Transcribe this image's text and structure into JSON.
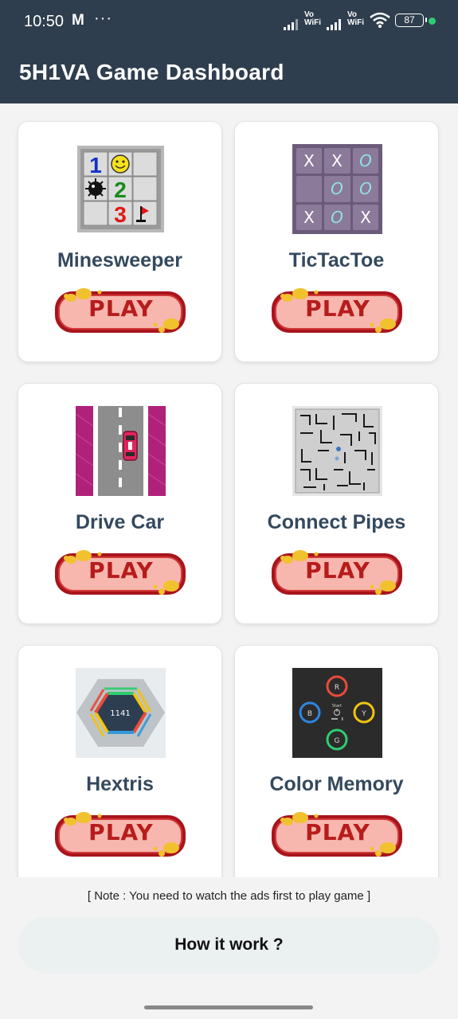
{
  "status_bar": {
    "time": "10:50",
    "mail_icon": "M",
    "dots": "···",
    "sim1_label_top": "Vo",
    "sim1_label_bottom": "WiFi",
    "sim2_label_top": "Vo",
    "sim2_label_bottom": "WiFi",
    "battery": "87"
  },
  "app_bar": {
    "title": "5H1VA Game Dashboard"
  },
  "games": [
    {
      "title": "Minesweeper",
      "icon": "minesweeper-icon",
      "play_label": "PLAY"
    },
    {
      "title": "TicTacToe",
      "icon": "tictactoe-icon",
      "play_label": "PLAY"
    },
    {
      "title": "Drive Car",
      "icon": "drive-car-icon",
      "play_label": "PLAY"
    },
    {
      "title": "Connect Pipes",
      "icon": "connect-pipes-icon",
      "play_label": "PLAY"
    },
    {
      "title": "Hextris",
      "icon": "hextris-icon",
      "play_label": "PLAY",
      "score": "1141"
    },
    {
      "title": "Color Memory",
      "icon": "color-memory-icon",
      "play_label": "PLAY"
    }
  ],
  "tictactoe_cells": [
    "X",
    "X",
    "O",
    "",
    "O",
    "O",
    "X",
    "O",
    "X"
  ],
  "minesweeper_cells": [
    "1",
    "",
    "",
    "",
    "2",
    "",
    "",
    "3",
    ""
  ],
  "color_memory": {
    "buttons": [
      "R",
      "B",
      "Y",
      "G"
    ],
    "center_label": "Start"
  },
  "footer": {
    "note": "[ Note : You need to watch the ads first to play game ]",
    "how_button": "How it work ?"
  },
  "colors": {
    "app_bar": "#2f3e4e",
    "card_title": "#34495e",
    "play_text": "#b71c1c",
    "play_gold": "#f2c12e"
  }
}
